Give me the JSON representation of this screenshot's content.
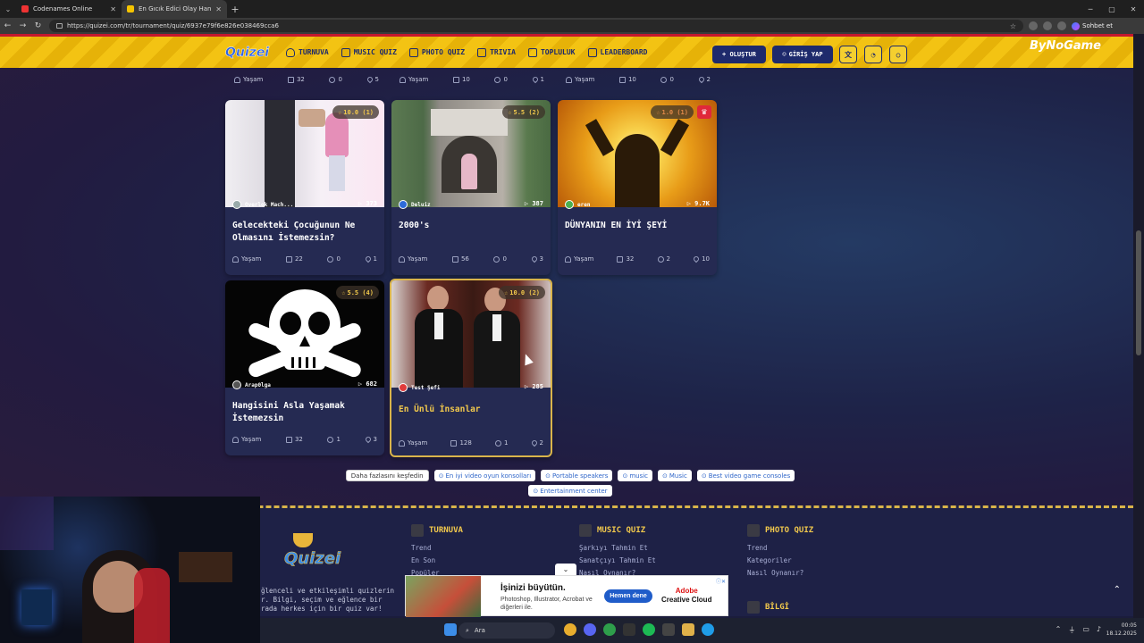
{
  "browser": {
    "tabs": [
      {
        "title": "Codenames Online",
        "active": false
      },
      {
        "title": "En Gıcık Edici Olay Hangisi? - Tier...",
        "active": true
      }
    ],
    "url": "https://quizei.com/tr/tournament/quiz/6937e79f6e826e038469cca6",
    "chat_button": "Sohbet et"
  },
  "header": {
    "logo": "Quizei",
    "nav": [
      {
        "label": "TURNUVA",
        "icon": "trophy-icon"
      },
      {
        "label": "MUSIC QUIZ",
        "icon": "music-note-icon"
      },
      {
        "label": "PHOTO QUIZ",
        "icon": "camera-icon"
      },
      {
        "label": "TRIVIA",
        "icon": "chat-question-icon"
      },
      {
        "label": "TOPLULUK",
        "icon": "users-icon"
      },
      {
        "label": "LEADERBOARD",
        "icon": "medal-icon"
      }
    ],
    "create_label": "+ OLUŞTUR",
    "login_label": "GİRİŞ YAP",
    "sponsor": "ByNoGame"
  },
  "top_row_stats": [
    {
      "category": "Yaşam",
      "questions": "32",
      "comments": "0",
      "likes": "5"
    },
    {
      "category": "Yaşam",
      "questions": "10",
      "comments": "0",
      "likes": "1"
    },
    {
      "category": "Yaşam",
      "questions": "10",
      "comments": "0",
      "likes": "2"
    }
  ],
  "cards": [
    {
      "rating": "10.0 (1)",
      "author": "Overlok Mach...",
      "plays": "373",
      "title": "Gelecekteki Çocuğunun Ne Olmasını İstemezsin?",
      "category": "Yaşam",
      "questions": "22",
      "comments": "0",
      "likes": "1",
      "image": "child-with-belt-image",
      "hover": false,
      "premium": false
    },
    {
      "rating": "5.5 (2)",
      "author": "Deluiz",
      "plays": "387",
      "title": "2000's",
      "category": "Yaşam",
      "questions": "56",
      "comments": "0",
      "likes": "3",
      "image": "toddler-playhouse-image",
      "hover": false,
      "premium": false
    },
    {
      "rating": "1.0 (1)",
      "author": "eren",
      "plays": "9.7K",
      "title": "DÜNYANIN EN İYİ ŞEYİ",
      "category": "Yaşam",
      "questions": "32",
      "comments": "2",
      "likes": "10",
      "image": "broken-chains-sunset-image",
      "hover": false,
      "premium": true
    },
    {
      "rating": "5.5 (4)",
      "author": "Arap0lga",
      "plays": "682",
      "title": "Hangisini Asla Yaşamak İstemezsin",
      "category": "Yaşam",
      "questions": "32",
      "comments": "1",
      "likes": "3",
      "image": "skull-crossbones-image",
      "hover": false,
      "premium": false
    },
    {
      "rating": "10.0 (2)",
      "author": "Test Şefi",
      "plays": "285",
      "title": "En Ünlü İnsanlar",
      "category": "Yaşam",
      "questions": "128",
      "comments": "1",
      "likes": "2",
      "image": "footballers-tuxedo-image",
      "hover": true,
      "premium": false
    }
  ],
  "chips": [
    {
      "label": "Daha fazlasını keşfedin",
      "first": true
    },
    {
      "label": "En iyi video oyun konsolları",
      "first": false
    },
    {
      "label": "Portable speakers",
      "first": false
    },
    {
      "label": "music",
      "first": false
    },
    {
      "label": "Music",
      "first": false
    },
    {
      "label": "Best video game consoles",
      "first": false
    },
    {
      "label": "Entertainment center",
      "first": false
    }
  ],
  "footer": {
    "logo": "Quizei",
    "about_lines": [
      "ğlenceli ve etkileşimli quizlerin",
      "r. Bilgi, seçim ve eğlence bir",
      "rada herkes için bir quiz var!"
    ],
    "columns": [
      {
        "heading": "TURNUVA",
        "links": [
          "Trend",
          "En Son",
          "Popüler"
        ]
      },
      {
        "heading": "MUSIC QUIZ",
        "links": [
          "Şarkıyı Tahmin Et",
          "Sanatçıyı Tahmin Et",
          "Nasıl Oynanır?"
        ]
      },
      {
        "heading": "PHOTO QUIZ",
        "links": [
          "Trend",
          "Kategoriler",
          "Nasıl Oynanır?"
        ]
      }
    ],
    "bilgi_heading": "BİLGİ"
  },
  "ad": {
    "headline": "İşinizi büyütün.",
    "subtext": "Photoshop, Illustrator, Acrobat ve diğerleri ile.",
    "button": "Hemen dene",
    "brand_line1": "Adobe",
    "brand_line2": "Creative Cloud"
  },
  "taskbar": {
    "search_placeholder": "Ara",
    "time": "00:05",
    "date": "18.12.2025"
  }
}
